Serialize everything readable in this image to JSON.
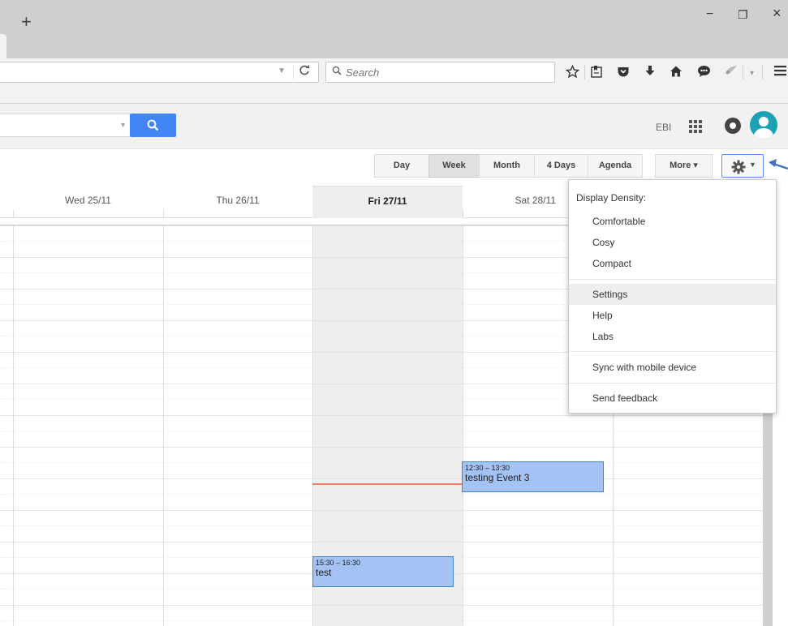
{
  "browser": {
    "new_tab": "+",
    "window_controls": {
      "minimize": "−",
      "restore": "❐",
      "close": "×"
    },
    "reload_glyph": "C",
    "search_placeholder": "Search",
    "toolbar_icons": [
      "star-icon",
      "bookmarks-list-icon",
      "pocket-icon",
      "download-icon",
      "home-icon",
      "chat-icon",
      "extension-icon",
      "menu-icon"
    ]
  },
  "header": {
    "account_label": "EBI",
    "search_button_color": "#4285f4",
    "avatar_color": "#1da2b4"
  },
  "views": {
    "day": "Day",
    "week": "Week",
    "month": "Month",
    "four_days": "4 Days",
    "agenda": "Agenda",
    "more": "More ▾",
    "active": "Week"
  },
  "calendar": {
    "columns": [
      {
        "label": "Wed 25/11",
        "today": false
      },
      {
        "label": "Thu 26/11",
        "today": false
      },
      {
        "label": "Fri 27/11",
        "today": true
      },
      {
        "label": "Sat 28/11",
        "today": false
      }
    ],
    "events": [
      {
        "time": "12:30 – 13:30",
        "title": "testing Event 3",
        "day": "Sat 28/11"
      },
      {
        "time": "15:30 – 16:30",
        "title": "test",
        "day": "Fri 27/11"
      }
    ],
    "event_color": "#a4c2f4",
    "current_time_line_color": "#f07d6a"
  },
  "settings_menu": {
    "header": "Display Density:",
    "density_options": [
      "Comfortable",
      "Cosy",
      "Compact"
    ],
    "items": [
      "Settings",
      "Help",
      "Labs"
    ],
    "sync": "Sync with mobile device",
    "feedback": "Send feedback",
    "highlighted": "Settings"
  }
}
